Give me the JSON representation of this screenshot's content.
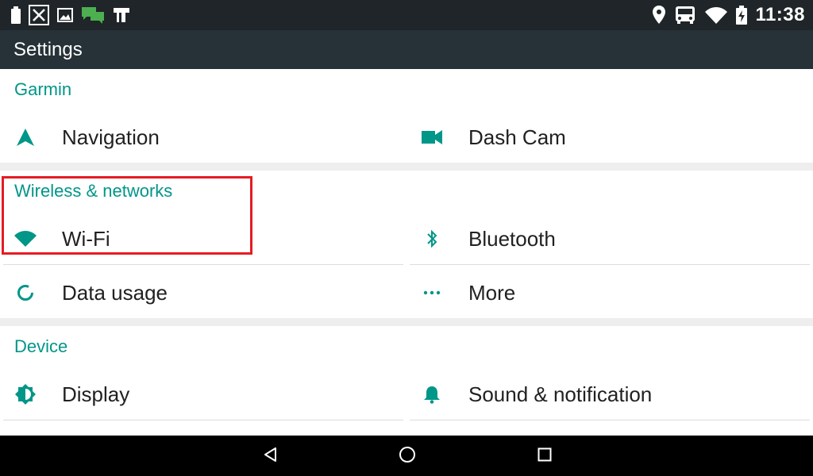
{
  "status_bar": {
    "time": "11:38",
    "left_icons": [
      "battery-saver-icon",
      "close-box-icon",
      "image-icon",
      "chat-icon",
      "t-logo-icon"
    ],
    "right_icons": [
      "location-pin-icon",
      "bus-icon",
      "wifi-icon",
      "battery-charging-icon"
    ]
  },
  "app_bar": {
    "title": "Settings"
  },
  "sections": {
    "garmin": {
      "title": "Garmin",
      "items": [
        {
          "label": "Navigation",
          "icon": "navigation-arrow-icon"
        },
        {
          "label": "Dash Cam",
          "icon": "video-camera-icon"
        }
      ]
    },
    "wireless": {
      "title": "Wireless & networks",
      "items": [
        {
          "label": "Wi-Fi",
          "icon": "wifi-icon"
        },
        {
          "label": "Bluetooth",
          "icon": "bluetooth-icon"
        },
        {
          "label": "Data usage",
          "icon": "data-usage-icon"
        },
        {
          "label": "More",
          "icon": "more-dots-icon"
        }
      ]
    },
    "device": {
      "title": "Device",
      "items": [
        {
          "label": "Display",
          "icon": "brightness-icon"
        },
        {
          "label": "Sound & notification",
          "icon": "bell-icon"
        }
      ]
    }
  },
  "nav_bar": {
    "buttons": [
      "back-icon",
      "home-icon",
      "recents-icon"
    ]
  },
  "colors": {
    "accent": "#009688",
    "highlight": "#e51c23",
    "app_bar": "#263238",
    "status_bar": "#1f2528"
  }
}
